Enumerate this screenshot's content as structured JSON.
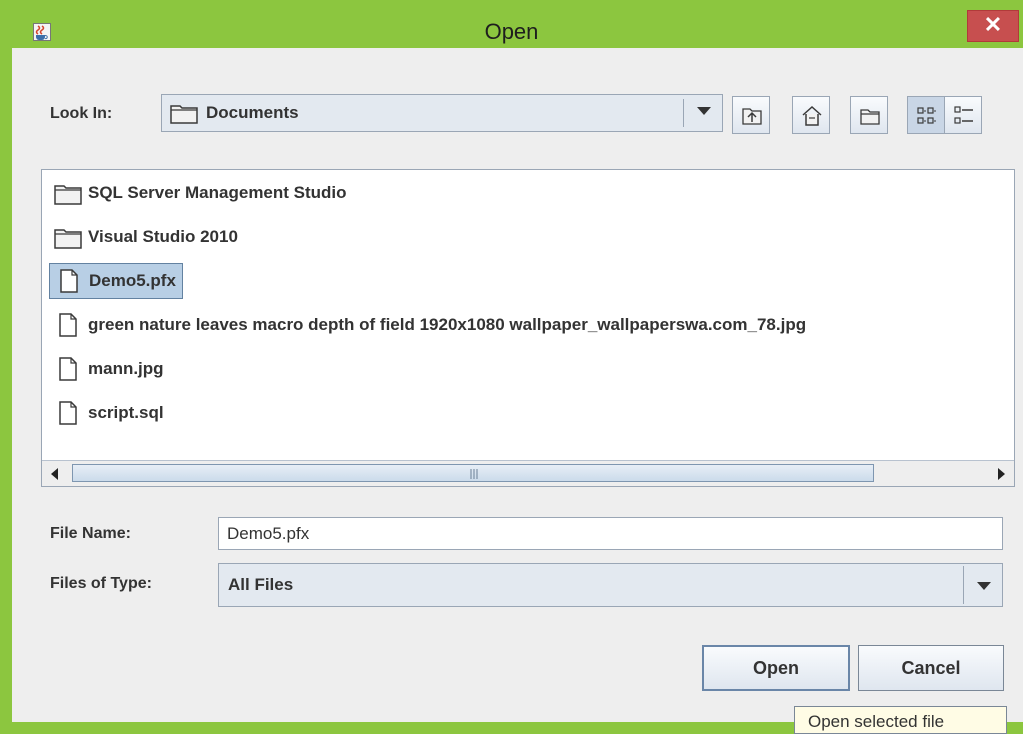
{
  "window": {
    "title": "Open",
    "close_label": "✕",
    "app_icon": "java-coffee-cup-icon"
  },
  "toolbar": {
    "look_in_label": "Look In:",
    "look_in_value": "Documents",
    "buttons": [
      {
        "name": "up-one-level-button",
        "icon": "folder-up-icon"
      },
      {
        "name": "home-button",
        "icon": "home-icon"
      },
      {
        "name": "new-folder-button",
        "icon": "new-folder-icon"
      },
      {
        "name": "list-view-button",
        "icon": "list-view-icon",
        "selected": true
      },
      {
        "name": "details-view-button",
        "icon": "details-view-icon"
      }
    ]
  },
  "files": [
    {
      "name": "SQL Server Management Studio",
      "type": "folder"
    },
    {
      "name": "Visual Studio 2010",
      "type": "folder"
    },
    {
      "name": "Demo5.pfx",
      "type": "file",
      "selected": true
    },
    {
      "name": "green nature leaves macro depth of field 1920x1080 wallpaper_wallpaperswa.com_78.jpg",
      "type": "file"
    },
    {
      "name": "mann.jpg",
      "type": "file"
    },
    {
      "name": "script.sql",
      "type": "file"
    }
  ],
  "form": {
    "file_name_label": "File Name:",
    "file_name_value": "Demo5.pfx",
    "files_of_type_label": "Files of Type:",
    "files_of_type_value": "All Files"
  },
  "buttons": {
    "open_label": "Open",
    "cancel_label": "Cancel"
  },
  "tooltip": {
    "text": "Open selected file"
  },
  "colors": {
    "window_frame": "#8cc63f",
    "client_bg": "#eeeeee",
    "selection_bg": "#b8cfe5",
    "close_button": "#c74f4f",
    "tooltip_bg": "#fffce5"
  }
}
